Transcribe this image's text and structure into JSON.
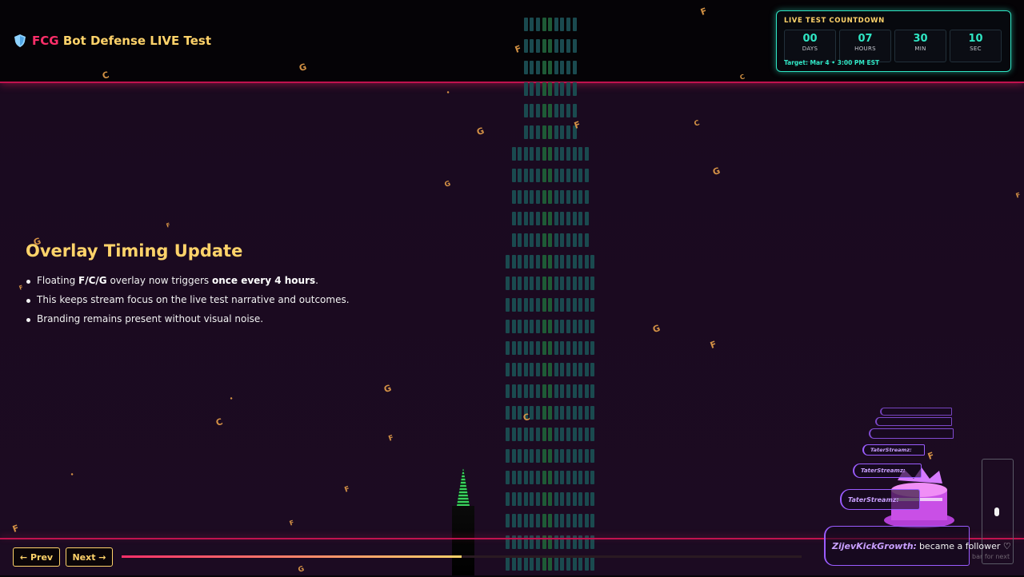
{
  "header": {
    "brand_fcg": "FCG",
    "brand_rest": "Bot Defense LIVE Test"
  },
  "countdown": {
    "title": "LIVE TEST COUNTDOWN",
    "units": [
      {
        "value": "00",
        "label": "DAYS"
      },
      {
        "value": "07",
        "label": "HOURS"
      },
      {
        "value": "30",
        "label": "MIN"
      },
      {
        "value": "10",
        "label": "SEC"
      }
    ],
    "target": "Target: Mar 4 • 3:00 PM EST"
  },
  "slide": {
    "title": "Overlay Timing Update",
    "bullets": [
      {
        "pre": "Floating ",
        "b1": "F/C/G",
        "mid": " overlay now triggers ",
        "b2": "once every 4 hours",
        "post": "."
      },
      {
        "text": "This keeps stream focus on the live test narrative and outcomes."
      },
      {
        "text": "Branding remains present without visual noise."
      }
    ]
  },
  "nav": {
    "prev_label": "← Prev",
    "next_label": "Next →",
    "progress": 0.5,
    "hint": "bar for next"
  },
  "chat": {
    "messages": [
      {
        "user": "TaterStreamz:",
        "text": ""
      },
      {
        "user": "TaterStreamz:",
        "text": ""
      },
      {
        "user": "TaterStreamz:",
        "text": ""
      },
      {
        "user": "ZijevKickGrowth:",
        "text": "became a follower ♡"
      }
    ]
  },
  "colors": {
    "accent_pink": "#ff2f6a",
    "accent_gold": "#ffd36a",
    "accent_teal": "#2fe6c4",
    "chat_purple": "#9b5cff"
  }
}
